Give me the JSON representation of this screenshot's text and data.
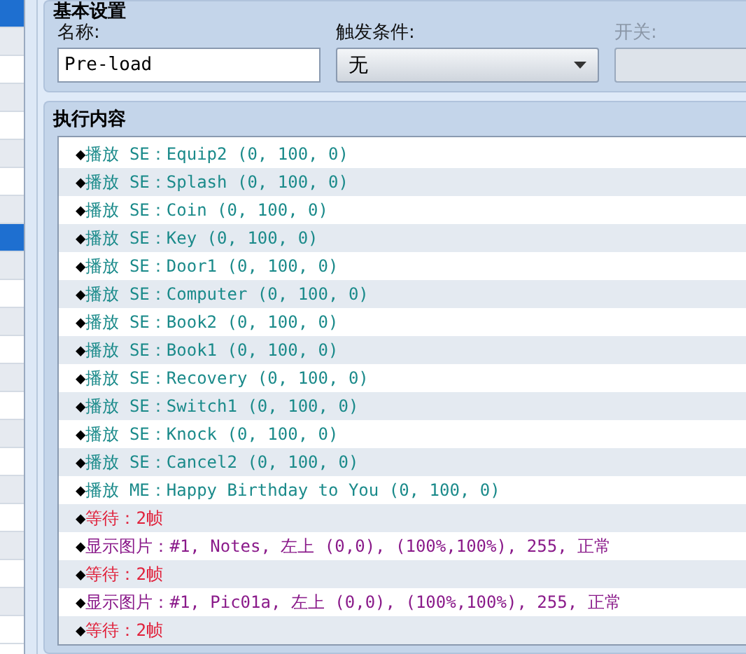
{
  "sidebar": {
    "items": [
      {
        "selected": true
      },
      {
        "selected": false
      },
      {
        "selected": false
      },
      {
        "selected": false
      },
      {
        "selected": false
      },
      {
        "selected": false
      },
      {
        "selected": false
      },
      {
        "selected": false
      },
      {
        "selected": true
      },
      {
        "selected": false
      },
      {
        "selected": false
      },
      {
        "selected": false
      },
      {
        "selected": false
      },
      {
        "selected": false
      },
      {
        "selected": false
      },
      {
        "selected": false
      },
      {
        "selected": false
      },
      {
        "selected": false
      },
      {
        "selected": false
      },
      {
        "selected": false
      },
      {
        "selected": false
      },
      {
        "selected": false
      },
      {
        "selected": false
      }
    ]
  },
  "basic_settings": {
    "title": "基本设置",
    "name": {
      "label": "名称:",
      "value": "Pre-load"
    },
    "trigger": {
      "label": "触发条件:",
      "value": "无"
    },
    "switch": {
      "label": "开关:",
      "disabled": true
    }
  },
  "contents": {
    "title": "执行内容",
    "commands": [
      {
        "kind": "se",
        "marker": "◆",
        "text": "播放 SE：Equip2 (0, 100, 0)"
      },
      {
        "kind": "se",
        "marker": "◆",
        "text": "播放 SE：Splash (0, 100, 0)"
      },
      {
        "kind": "se",
        "marker": "◆",
        "text": "播放 SE：Coin (0, 100, 0)"
      },
      {
        "kind": "se",
        "marker": "◆",
        "text": "播放 SE：Key (0, 100, 0)"
      },
      {
        "kind": "se",
        "marker": "◆",
        "text": "播放 SE：Door1 (0, 100, 0)"
      },
      {
        "kind": "se",
        "marker": "◆",
        "text": "播放 SE：Computer (0, 100, 0)"
      },
      {
        "kind": "se",
        "marker": "◆",
        "text": "播放 SE：Book2 (0, 100, 0)"
      },
      {
        "kind": "se",
        "marker": "◆",
        "text": "播放 SE：Book1 (0, 100, 0)"
      },
      {
        "kind": "se",
        "marker": "◆",
        "text": "播放 SE：Recovery (0, 100, 0)"
      },
      {
        "kind": "se",
        "marker": "◆",
        "text": "播放 SE：Switch1 (0, 100, 0)"
      },
      {
        "kind": "se",
        "marker": "◆",
        "text": "播放 SE：Knock (0, 100, 0)"
      },
      {
        "kind": "se",
        "marker": "◆",
        "text": "播放 SE：Cancel2 (0, 100, 0)"
      },
      {
        "kind": "se",
        "marker": "◆",
        "text": "播放 ME：Happy Birthday to You (0, 100, 0)"
      },
      {
        "kind": "wait",
        "marker": "◆",
        "text": "等待：2帧"
      },
      {
        "kind": "picture",
        "marker": "◆",
        "text": "显示图片：#1, Notes, 左上 (0,0), (100%,100%), 255, 正常"
      },
      {
        "kind": "wait",
        "marker": "◆",
        "text": "等待：2帧"
      },
      {
        "kind": "picture",
        "marker": "◆",
        "text": "显示图片：#1, Pic01a, 左上 (0,0), (100%,100%), 255, 正常"
      },
      {
        "kind": "wait",
        "marker": "◆",
        "text": "等待：2帧"
      }
    ]
  }
}
